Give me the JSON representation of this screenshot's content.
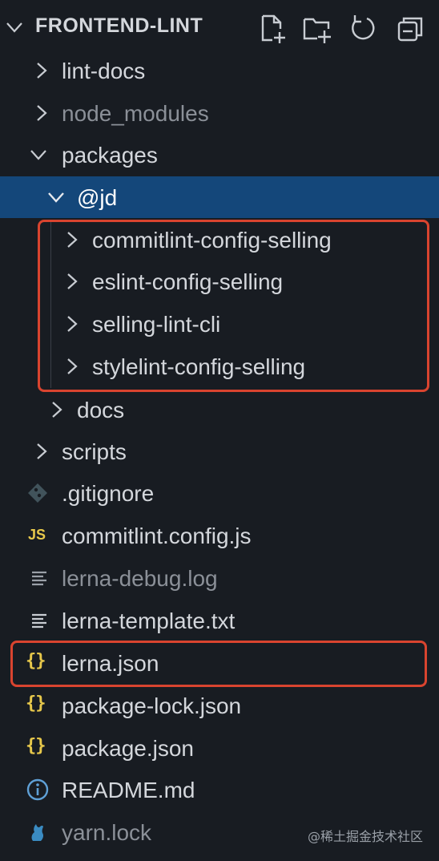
{
  "explorer": {
    "title": "FRONTEND-LINT",
    "actions": [
      {
        "name": "new-file-icon"
      },
      {
        "name": "new-folder-icon"
      },
      {
        "name": "refresh-icon"
      },
      {
        "name": "collapse-all-icon"
      }
    ]
  },
  "tree": {
    "lint_docs": "lint-docs",
    "node_modules": "node_modules",
    "packages": "packages",
    "jd": "@jd",
    "commitlint_config_selling": "commitlint-config-selling",
    "eslint_config_selling": "eslint-config-selling",
    "selling_lint_cli": "selling-lint-cli",
    "stylelint_config_selling": "stylelint-config-selling",
    "docs": "docs",
    "scripts": "scripts",
    "gitignore": ".gitignore",
    "commitlint_config_js": "commitlint.config.js",
    "lerna_debug_log": "lerna-debug.log",
    "lerna_template_txt": "lerna-template.txt",
    "lerna_json": "lerna.json",
    "package_lock_json": "package-lock.json",
    "package_json": "package.json",
    "readme_md": "README.md",
    "yarn_lock": "yarn.lock"
  },
  "icons": {
    "js_badge": "JS",
    "json_badge": "{}"
  },
  "colors": {
    "background": "#181c22",
    "selected_row": "#14477a",
    "highlight_box": "#d9442f",
    "json_icon": "#e7c84b",
    "dimmed_text": "#8b9098"
  },
  "watermark": "@稀土掘金技术社区"
}
